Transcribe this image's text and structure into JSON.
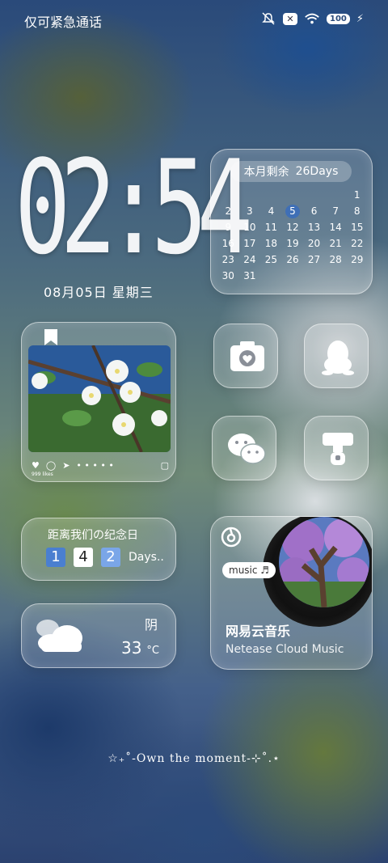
{
  "status_bar": {
    "left_text": "仅可紧急通话",
    "icons": [
      "mute-icon",
      "no-sim-icon",
      "wifi-icon",
      "battery-icon",
      "charging-icon"
    ],
    "wifi_label": "6",
    "battery_level": "100"
  },
  "clock": {
    "time": "02:54",
    "date": "08月05日  星期三"
  },
  "calendar": {
    "header_label": "本月剩余",
    "remaining": "26Days",
    "today": "5",
    "days": [
      "",
      "",
      "",
      "",
      "",
      "",
      "1",
      "2",
      "3",
      "4",
      "5",
      "6",
      "7",
      "8",
      "9",
      "10",
      "11",
      "12",
      "13",
      "14",
      "15",
      "16",
      "17",
      "18",
      "19",
      "20",
      "21",
      "22",
      "23",
      "24",
      "25",
      "26",
      "27",
      "28",
      "29",
      "30",
      "31",
      "",
      "",
      "",
      "",
      ""
    ]
  },
  "photo_widget": {
    "likes": "999 likes",
    "dots": "• • • • •"
  },
  "apps": [
    {
      "name": "camera",
      "icon": "camera-icon"
    },
    {
      "name": "qq",
      "icon": "penguin-icon"
    },
    {
      "name": "wechat",
      "icon": "chat-bubbles-icon"
    },
    {
      "name": "theme",
      "icon": "paint-roller-icon"
    }
  ],
  "anniversary": {
    "title": "距离我们の纪念日",
    "digits": [
      "1",
      "4",
      "2"
    ],
    "suffix": "Days.."
  },
  "weather": {
    "condition": "阴",
    "temperature": "33",
    "unit": "°C",
    "icon": "cloudy-icon"
  },
  "music": {
    "badge": "music ♬",
    "title": "网易云音乐",
    "subtitle": "Netease Cloud Music"
  },
  "quote": "☆₊˚-Own the moment-⊹˚.⋆"
}
